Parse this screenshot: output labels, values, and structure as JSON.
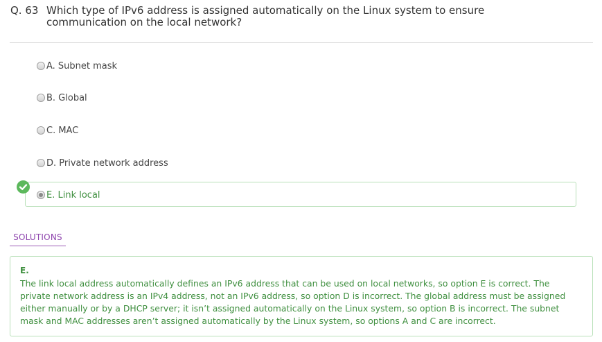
{
  "question": {
    "number": "Q. 63",
    "text": "Which type of IPv6 address is assigned automatically on the Linux system to ensure communication on the local network?"
  },
  "options": [
    {
      "label": "A. Subnet mask",
      "selected": false
    },
    {
      "label": "B. Global",
      "selected": false
    },
    {
      "label": "C. MAC",
      "selected": false
    },
    {
      "label": "D. Private network address",
      "selected": false
    },
    {
      "label": "E. Link local",
      "selected": true,
      "correct": true
    }
  ],
  "solutions": {
    "tab_label": "SOLUTIONS",
    "answer": "E.",
    "explanation": "The link local address automatically defines an IPv6 address that can be used on local networks, so option E is correct. The private network address is an IPv4 address, not an IPv6 address, so option D is incorrect. The global address must be assigned either manually or by a DHCP server; it isn’t assigned automatically on the Linux system, so option B is incorrect. The subnet mask and MAC addresses aren’t assigned automatically by the Linux system, so options A and C are incorrect."
  },
  "icons": {
    "correct": "check-circle-icon",
    "option": "radio-icon"
  },
  "colors": {
    "correct_green": "#3f8f3f",
    "correct_border": "#b8e0b8",
    "check_badge": "#5cb85c",
    "solutions_tab": "#8e44ad"
  }
}
